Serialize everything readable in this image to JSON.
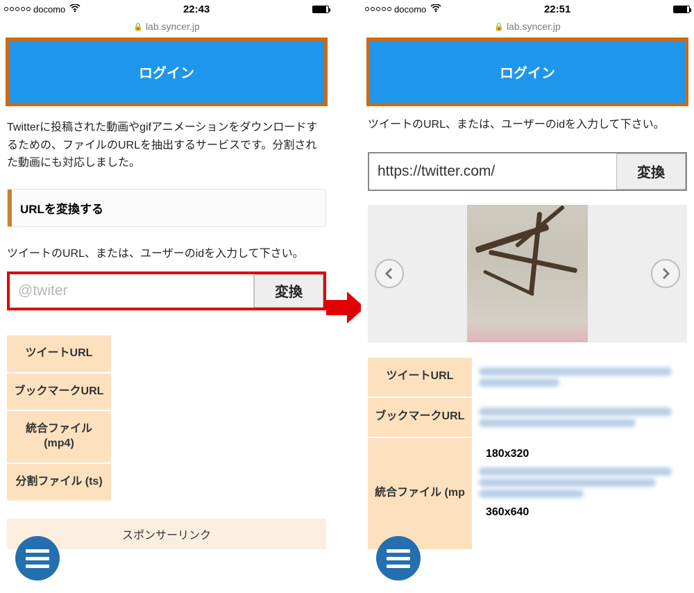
{
  "left": {
    "status": {
      "carrier": "docomo",
      "time": "22:43"
    },
    "url": "lab.syncer.jp",
    "login": "ログイン",
    "description": "Twitterに投稿された動画やgifアニメーションをダウンロードするための、ファイルのURLを抽出するサービスです。分割された動画にも対応しました。",
    "section_title": "URLを変換する",
    "instruction": "ツイートのURL、または、ユーザーのidを入力して下さい。",
    "placeholder": "@twiter",
    "convert": "変換",
    "table": {
      "r1": "ツイートURL",
      "r2": "ブックマークURL",
      "r3": "統合ファイル (mp4)",
      "r4": "分割ファイル (ts)"
    },
    "sponsor": "スポンサーリンク"
  },
  "right": {
    "status": {
      "carrier": "docomo",
      "time": "22:51"
    },
    "url": "lab.syncer.jp",
    "login": "ログイン",
    "instruction": "ツイートのURL、または、ユーザーのidを入力して下さい。",
    "input_value": "https://twitter.com/",
    "convert": "変換",
    "table": {
      "r1": "ツイートURL",
      "r2": "ブックマークURL",
      "r3": "統合ファイル (mp",
      "size1": "180x320",
      "size2": "360x640"
    }
  }
}
